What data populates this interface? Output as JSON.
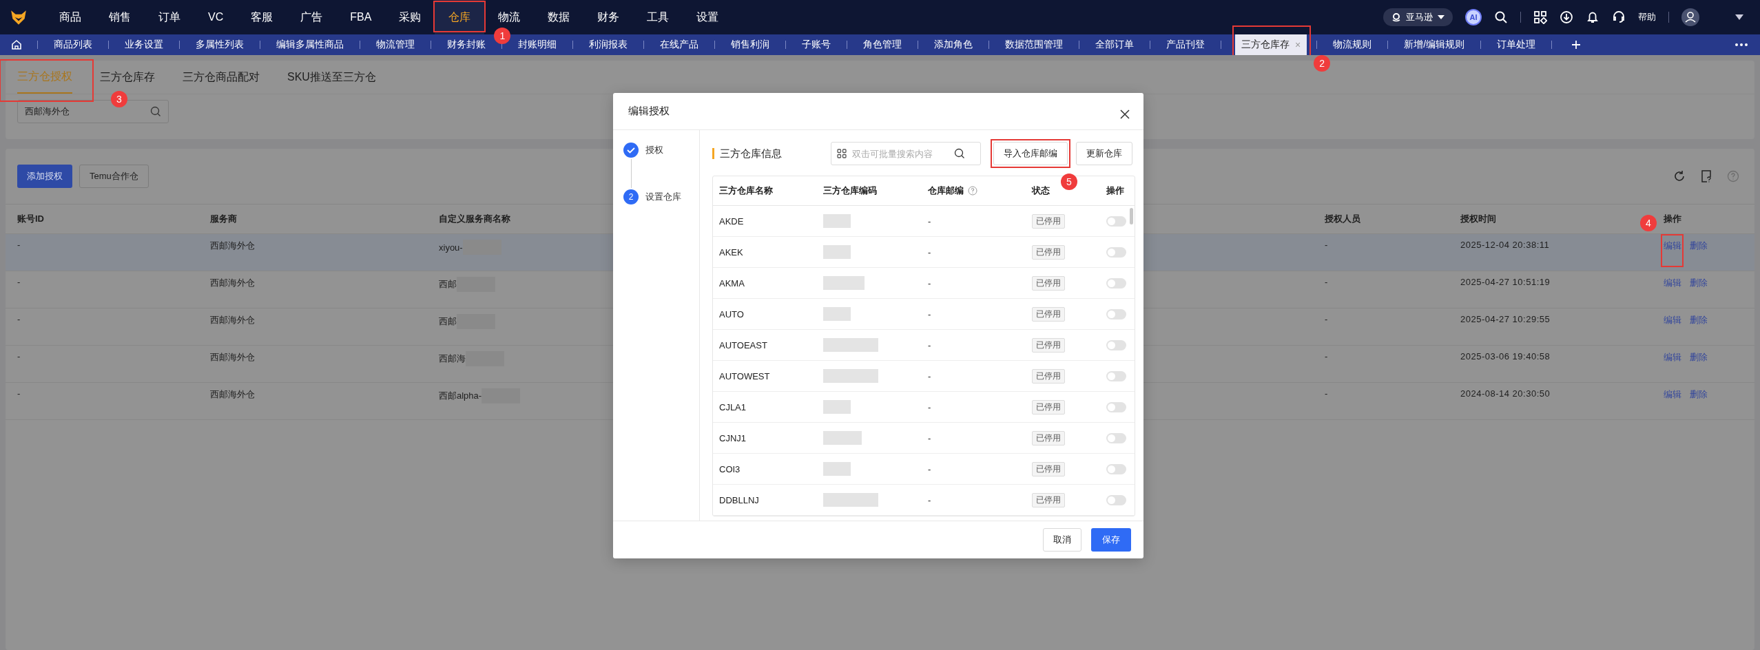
{
  "nav": {
    "items": [
      {
        "label": "商品",
        "selected": false
      },
      {
        "label": "销售",
        "selected": false
      },
      {
        "label": "订单",
        "selected": false
      },
      {
        "label": "VC",
        "selected": false
      },
      {
        "label": "客服",
        "selected": false
      },
      {
        "label": "广告",
        "selected": false
      },
      {
        "label": "FBA",
        "selected": false
      },
      {
        "label": "采购",
        "selected": false
      },
      {
        "label": "仓库",
        "selected": true,
        "callout": "1"
      },
      {
        "label": "物流",
        "selected": false
      },
      {
        "label": "数据",
        "selected": false
      },
      {
        "label": "财务",
        "selected": false
      },
      {
        "label": "工具",
        "selected": false
      },
      {
        "label": "设置",
        "selected": false
      }
    ],
    "store": "亚马逊",
    "ai": "AI",
    "help": "帮助"
  },
  "tabs": [
    {
      "label": "商品列表",
      "selected": false
    },
    {
      "label": "业务设置",
      "selected": false
    },
    {
      "label": "多属性列表",
      "selected": false
    },
    {
      "label": "编辑多属性商品",
      "selected": false
    },
    {
      "label": "物流管理",
      "selected": false
    },
    {
      "label": "财务封账",
      "selected": false
    },
    {
      "label": "封账明细",
      "selected": false
    },
    {
      "label": "利润报表",
      "selected": false
    },
    {
      "label": "在线产品",
      "selected": false
    },
    {
      "label": "销售利润",
      "selected": false
    },
    {
      "label": "子账号",
      "selected": false
    },
    {
      "label": "角色管理",
      "selected": false
    },
    {
      "label": "添加角色",
      "selected": false
    },
    {
      "label": "数据范围管理",
      "selected": false
    },
    {
      "label": "全部订单",
      "selected": false
    },
    {
      "label": "产品刊登",
      "selected": false
    },
    {
      "label": "三方仓库存",
      "selected": true,
      "close": "×",
      "callout": "2"
    },
    {
      "label": "物流规则",
      "selected": false
    },
    {
      "label": "新增/编辑规则",
      "selected": false
    },
    {
      "label": "订单处理",
      "selected": false
    }
  ],
  "subtabs": [
    {
      "label": "三方仓授权",
      "selected": true,
      "callout": "3"
    },
    {
      "label": "三方仓库存",
      "selected": false
    },
    {
      "label": "三方仓商品配对",
      "selected": false
    },
    {
      "label": "SKU推送至三方仓",
      "selected": false
    }
  ],
  "search": {
    "value": "西邮海外仓"
  },
  "toolbar": {
    "buttons": [
      {
        "label": "添加授权",
        "kind": "primary"
      },
      {
        "label": "Temu合作仓",
        "kind": "default"
      }
    ]
  },
  "table": {
    "columns": [
      "账号ID",
      "服务商",
      "自定义服务商名称",
      "授权人员",
      "授权时间",
      "操作"
    ],
    "rows": [
      {
        "account_id": "-",
        "provider": "西邮海外仓",
        "custom_name": "xiyou-",
        "authorizer": "-",
        "time": "2025-12-04 20:38:11",
        "selected": true,
        "actions": [
          {
            "label": "编辑",
            "callout": "4"
          },
          {
            "label": "删除"
          }
        ]
      },
      {
        "account_id": "-",
        "provider": "西邮海外仓",
        "custom_name": "西邮",
        "authorizer": "-",
        "time": "2025-04-27 10:51:19",
        "selected": false,
        "actions": [
          {
            "label": "编辑"
          },
          {
            "label": "删除"
          }
        ]
      },
      {
        "account_id": "-",
        "provider": "西邮海外仓",
        "custom_name": "西邮",
        "authorizer": "-",
        "time": "2025-04-27 10:29:55",
        "selected": false,
        "actions": [
          {
            "label": "编辑"
          },
          {
            "label": "删除"
          }
        ]
      },
      {
        "account_id": "-",
        "provider": "西邮海外仓",
        "custom_name": "西邮海",
        "authorizer": "-",
        "time": "2025-03-06 19:40:58",
        "selected": false,
        "actions": [
          {
            "label": "编辑"
          },
          {
            "label": "删除"
          }
        ]
      },
      {
        "account_id": "-",
        "provider": "西邮海外仓",
        "custom_name": "西邮alpha-",
        "authorizer": "-",
        "time": "2024-08-14 20:30:50",
        "selected": false,
        "actions": [
          {
            "label": "编辑"
          },
          {
            "label": "删除"
          }
        ]
      }
    ]
  },
  "dialog": {
    "title": "编辑授权",
    "steps": [
      {
        "label": "授权",
        "done": true
      },
      {
        "label": "设置仓库",
        "number": "2",
        "done": false
      }
    ],
    "section_title": "三方仓库信息",
    "search_placeholder": "双击可批量搜索内容",
    "buttons": [
      {
        "label": "导入仓库邮编",
        "callout": "5"
      },
      {
        "label": "更新仓库"
      }
    ],
    "columns": [
      {
        "label": "三方仓库名称"
      },
      {
        "label": "三方仓库编码"
      },
      {
        "label": "仓库邮编",
        "help": true
      },
      {
        "label": "状态"
      },
      {
        "label": "操作"
      }
    ],
    "rows": [
      {
        "name": "AKDE",
        "zip": "-",
        "status": "已停用",
        "enabled": false
      },
      {
        "name": "AKEK",
        "zip": "-",
        "status": "已停用",
        "enabled": false
      },
      {
        "name": "AKMA",
        "zip": "-",
        "status": "已停用",
        "enabled": false
      },
      {
        "name": "AUTO",
        "zip": "-",
        "status": "已停用",
        "enabled": false
      },
      {
        "name": "AUTOEAST",
        "zip": "-",
        "status": "已停用",
        "enabled": false
      },
      {
        "name": "AUTOWEST",
        "zip": "-",
        "status": "已停用",
        "enabled": false
      },
      {
        "name": "CJLA1",
        "zip": "-",
        "status": "已停用",
        "enabled": false
      },
      {
        "name": "CJNJ1",
        "zip": "-",
        "status": "已停用",
        "enabled": false
      },
      {
        "name": "COI3",
        "zip": "-",
        "status": "已停用",
        "enabled": false
      },
      {
        "name": "DDBLLNJ",
        "zip": "-",
        "status": "已停用",
        "enabled": false
      }
    ],
    "footer": [
      {
        "label": "取消",
        "kind": "default"
      },
      {
        "label": "保存",
        "kind": "primary"
      }
    ]
  }
}
